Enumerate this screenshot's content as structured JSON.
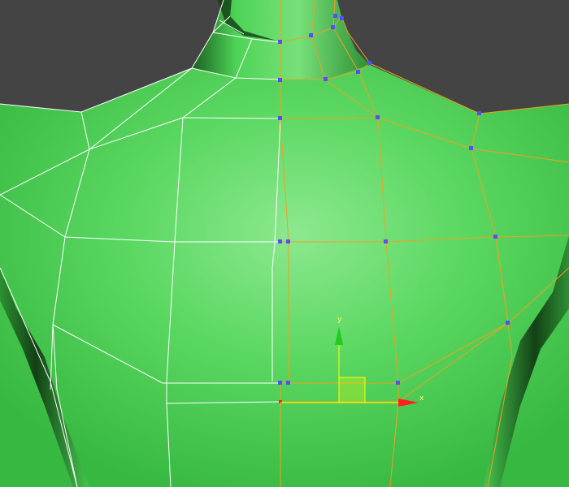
{
  "viewport": {
    "background": "#444444",
    "mesh_color": "#4fd45a",
    "mesh_highlight": "#8de88f",
    "wire_unselected": "#ffffff",
    "wire_selected": "#f0a020",
    "vertex_color": "#5050ff"
  },
  "gizmo": {
    "x_label": "x",
    "y_label": "y",
    "x_color": "#ff2020",
    "y_color": "#20cc20",
    "plane_color": "#ffff00"
  },
  "icons": {
    "mesh": "torso-mesh-icon",
    "gizmo": "move-gizmo-icon"
  }
}
